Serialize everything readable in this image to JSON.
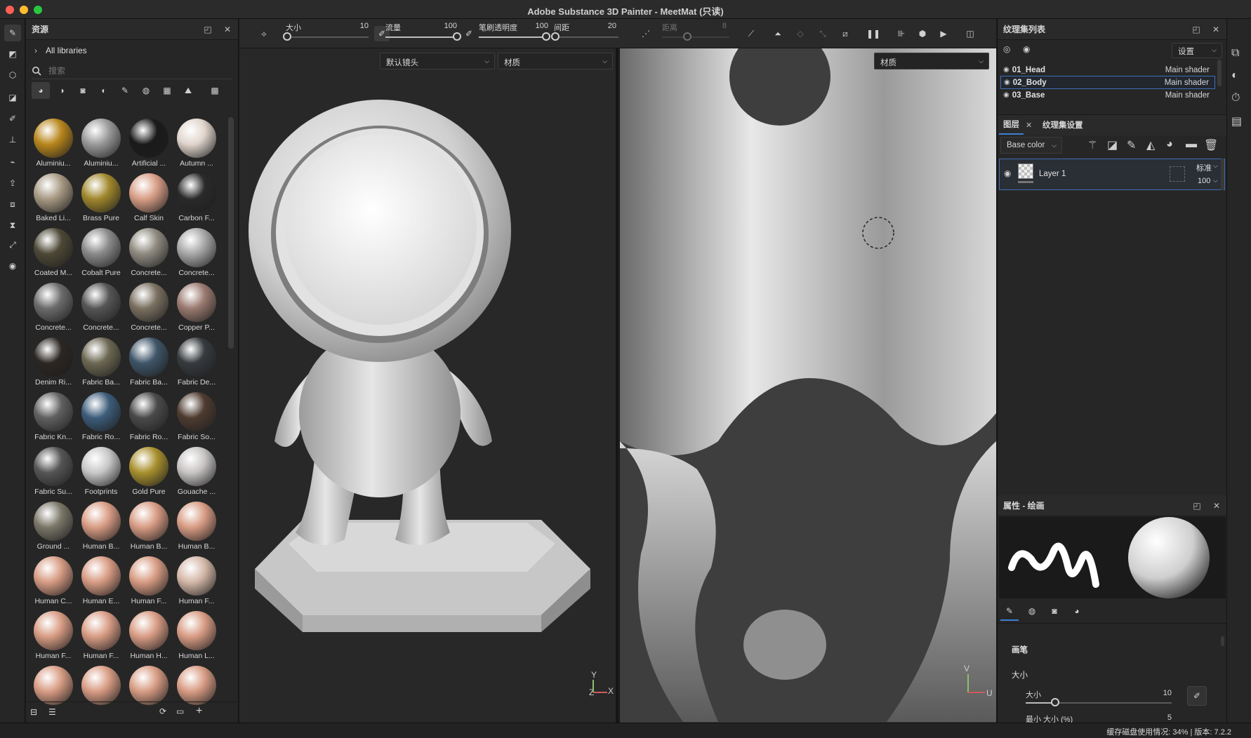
{
  "window": {
    "title": "Adobe Substance 3D Painter - MeetMat (只读)",
    "traffic_colors": [
      "#fe5f57",
      "#febc2e",
      "#28c840"
    ]
  },
  "tools": [
    {
      "name": "paint-brush-icon",
      "glyph": "✎"
    },
    {
      "name": "eraser-icon",
      "glyph": "◩"
    },
    {
      "name": "projection-icon",
      "glyph": "⬡"
    },
    {
      "name": "polygon-fill-icon",
      "glyph": "◪"
    },
    {
      "name": "smudge-icon",
      "glyph": "✐"
    },
    {
      "name": "clone-stamp-icon",
      "glyph": "⊥"
    },
    {
      "name": "color-picker-icon",
      "glyph": "⌁"
    },
    {
      "name": "bake-icon",
      "glyph": "⇪"
    },
    {
      "name": "geometry-mask-icon",
      "glyph": "⧈"
    },
    {
      "name": "measure-icon",
      "glyph": "⧗"
    },
    {
      "name": "transform-icon",
      "glyph": "⤢"
    },
    {
      "name": "camera-view-icon",
      "glyph": "◉"
    }
  ],
  "assets": {
    "title": "资源",
    "library": "All libraries",
    "search_placeholder": "搜索",
    "items": [
      {
        "label": "Aluminiu...",
        "color": "#b8861c"
      },
      {
        "label": "Aluminiu...",
        "color": "#9a9a9a"
      },
      {
        "label": "Artificial ...",
        "color": "#1a1a1a"
      },
      {
        "label": "Autumn ...",
        "color": "#e0d5cc"
      },
      {
        "label": "Baked Li...",
        "color": "#a89a84"
      },
      {
        "label": "Brass Pure",
        "color": "#a0872c"
      },
      {
        "label": "Calf Skin",
        "color": "#d89e86"
      },
      {
        "label": "Carbon F...",
        "color": "#2a2a2a"
      },
      {
        "label": "Coated M...",
        "color": "#4d4836"
      },
      {
        "label": "Cobalt Pure",
        "color": "#8a8a8a"
      },
      {
        "label": "Concrete...",
        "color": "#8f8a80"
      },
      {
        "label": "Concrete...",
        "color": "#a8a8a8"
      },
      {
        "label": "Concrete...",
        "color": "#6b6b6b"
      },
      {
        "label": "Concrete...",
        "color": "#555555"
      },
      {
        "label": "Concrete...",
        "color": "#7a7060"
      },
      {
        "label": "Copper P...",
        "color": "#9a7a70"
      },
      {
        "label": "Denim Ri...",
        "color": "#2b2622"
      },
      {
        "label": "Fabric Ba...",
        "color": "#6b6752"
      },
      {
        "label": "Fabric Ba...",
        "color": "#3e5568"
      },
      {
        "label": "Fabric De...",
        "color": "#363a3e"
      },
      {
        "label": "Fabric Kn...",
        "color": "#606060"
      },
      {
        "label": "Fabric Ro...",
        "color": "#3c5c7a"
      },
      {
        "label": "Fabric Ro...",
        "color": "#4a4a4a"
      },
      {
        "label": "Fabric So...",
        "color": "#4e3b30"
      },
      {
        "label": "Fabric Su...",
        "color": "#555555"
      },
      {
        "label": "Footprints",
        "color": "#c8c8c8"
      },
      {
        "label": "Gold Pure",
        "color": "#a8902e"
      },
      {
        "label": "Gouache ...",
        "color": "#c8c4c4"
      },
      {
        "label": "Ground ...",
        "color": "#7a7668"
      },
      {
        "label": "Human B...",
        "color": "#d89c84"
      },
      {
        "label": "Human B...",
        "color": "#d89c84"
      },
      {
        "label": "Human B...",
        "color": "#d89c84"
      },
      {
        "label": "Human C...",
        "color": "#d89c84"
      },
      {
        "label": "Human E...",
        "color": "#d89c84"
      },
      {
        "label": "Human F...",
        "color": "#d89c84"
      },
      {
        "label": "Human F...",
        "color": "#d4b8a8"
      },
      {
        "label": "Human F...",
        "color": "#d89c84"
      },
      {
        "label": "Human F...",
        "color": "#d89c84"
      },
      {
        "label": "Human H...",
        "color": "#d89c84"
      },
      {
        "label": "Human L...",
        "color": "#d89c84"
      },
      {
        "label": "",
        "color": "#d89c84"
      },
      {
        "label": "",
        "color": "#d89c84"
      },
      {
        "label": "",
        "color": "#d89c84"
      },
      {
        "label": "",
        "color": "#d89c84"
      }
    ]
  },
  "toolbar": {
    "size_label": "大小",
    "size_value": "10",
    "size_fraction": 0.02,
    "flow_label": "流量",
    "flow_value": "100",
    "flow_fraction": 1.0,
    "opacity_label": "笔刷透明度",
    "opacity_value": "100",
    "opacity_fraction": 1.0,
    "spacing_label": "间距",
    "spacing_value": "20",
    "spacing_fraction": 0.02,
    "distance_label": "距离",
    "distance_value": "8"
  },
  "viewport3d": {
    "camera_select": "默认镜头",
    "mode_select": "材质",
    "axis_y": "Y",
    "axis_x": "X",
    "axis_z": "Z"
  },
  "viewport2d": {
    "mode_select": "材质",
    "axis_v": "V",
    "axis_u": "U"
  },
  "texture_sets": {
    "title": "纹理集列表",
    "settings_label": "设置",
    "items": [
      {
        "name": "01_Head",
        "shader": "Main shader",
        "selected": false
      },
      {
        "name": "02_Body",
        "shader": "Main shader",
        "selected": true
      },
      {
        "name": "03_Base",
        "shader": "Main shader",
        "selected": false
      }
    ]
  },
  "layers": {
    "tab_layers": "图层",
    "tab_settings": "纹理集设置",
    "channel": "Base color",
    "layer_name": "Layer 1",
    "blend_mode": "标准",
    "opacity": "100"
  },
  "properties": {
    "title": "属性 - 绘画",
    "section_brush": "画笔",
    "subsection_size": "大小",
    "size_label": "大小",
    "size_value": "10",
    "size_fraction": 0.2,
    "min_size_label": "最小 大小 (%)",
    "min_size_value": "5"
  },
  "status": {
    "text": "缓存磁盘使用情况:   34% | 版本:   7.2.2"
  },
  "colors": {
    "accent": "#3d7fd6",
    "panel": "#262626"
  }
}
